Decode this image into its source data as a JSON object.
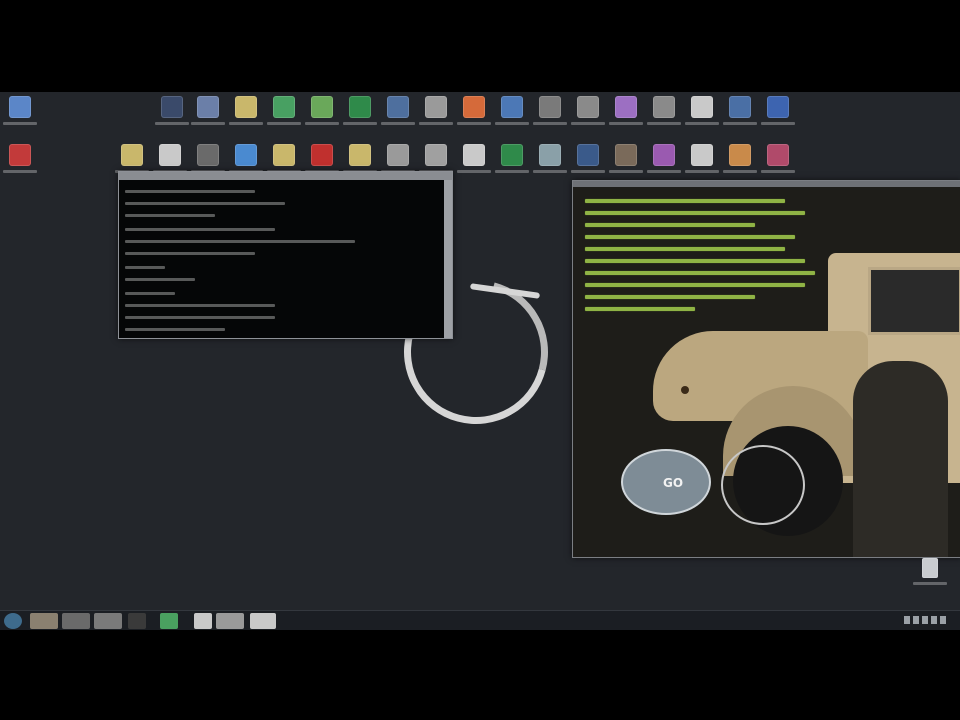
{
  "desktop": {
    "background": "#23262b",
    "icons_row1": [
      {
        "icon": "computer-icon",
        "color": "#5b86c8"
      },
      {
        "icon": "app-icon",
        "color": "#3a4a6a"
      },
      {
        "icon": "monitor-icon",
        "color": "#6b7fa8"
      },
      {
        "icon": "folder-icon",
        "color": "#c9b76b"
      },
      {
        "icon": "green-app-icon",
        "color": "#48a062"
      },
      {
        "icon": "ribbon-icon",
        "color": "#6aa85a"
      },
      {
        "icon": "spreadsheet-icon",
        "color": "#2f8a4a"
      },
      {
        "icon": "steam-icon",
        "color": "#4e6f9e"
      },
      {
        "icon": "music-icon",
        "color": "#9a9a9a"
      },
      {
        "icon": "browser-icon",
        "color": "#d56a3a"
      },
      {
        "icon": "arrow-icon",
        "color": "#4c78b6"
      },
      {
        "icon": "clock-icon",
        "color": "#7a7a7a"
      },
      {
        "icon": "music-file-icon",
        "color": "#8a8a8a"
      },
      {
        "icon": "note-icon",
        "color": "#9c6fc2"
      },
      {
        "icon": "tools-icon",
        "color": "#8a8a8a"
      },
      {
        "icon": "document-icon",
        "color": "#c9c9c9"
      },
      {
        "icon": "v-app-icon",
        "color": "#4a6fa5"
      },
      {
        "icon": "music-app-icon",
        "color": "#3d64b0"
      }
    ],
    "icons_row2": [
      {
        "icon": "record-icon",
        "color": "#c23a3a"
      },
      {
        "icon": "folder-icon",
        "color": "#c9b76b"
      },
      {
        "icon": "document-icon",
        "color": "#c9c9c9"
      },
      {
        "icon": "archive-icon",
        "color": "#6a6a6a"
      },
      {
        "icon": "shark-icon",
        "color": "#4a8ad0"
      },
      {
        "icon": "folder-icon",
        "color": "#c9b76b"
      },
      {
        "icon": "filezilla-icon",
        "color": "#c0302e"
      },
      {
        "icon": "folder-icon",
        "color": "#c9b76b"
      },
      {
        "icon": "window-icon",
        "color": "#9a9a9a"
      },
      {
        "icon": "window-icon",
        "color": "#a0a0a0"
      },
      {
        "icon": "document-icon",
        "color": "#c9c9c9"
      },
      {
        "icon": "excel-icon",
        "color": "#2f8a4a"
      },
      {
        "icon": "chart-icon",
        "color": "#8aa0a8"
      },
      {
        "icon": "globe-icon",
        "color": "#3a5a8a"
      },
      {
        "icon": "card-icon",
        "color": "#7a6a5a"
      },
      {
        "icon": "disc-icon",
        "color": "#9a5ab0"
      },
      {
        "icon": "document-icon",
        "color": "#c9c9c9"
      },
      {
        "icon": "folder-icon",
        "color": "#c98a4a"
      },
      {
        "icon": "media-icon",
        "color": "#b04a6a"
      }
    ],
    "recycle_bin": {
      "icon": "recycle-bin-icon"
    }
  },
  "cmd_window": {
    "icon": "terminal-icon"
  },
  "game_window": {
    "minimap_label": "GO",
    "icon": "game-icon"
  },
  "taskbar": {
    "start_icon": "start-orb-icon",
    "items": [
      {
        "icon": "folder-taskbar-icon",
        "color": "#8a8070"
      },
      {
        "icon": "window-taskbar-icon",
        "color": "#6a6a6a"
      },
      {
        "icon": "media-taskbar-icon",
        "color": "#7a7a7a"
      },
      {
        "icon": "terminal-taskbar-icon",
        "color": "#3a3a3a"
      },
      {
        "icon": "chrome-taskbar-icon",
        "color": "#4aa060"
      },
      {
        "icon": "document-taskbar-icon",
        "color": "#c9c9c9"
      },
      {
        "icon": "game-taskbar-icon",
        "color": "#9a9a9a"
      },
      {
        "icon": "window-taskbar-icon",
        "color": "#c9c9c9"
      }
    ]
  }
}
